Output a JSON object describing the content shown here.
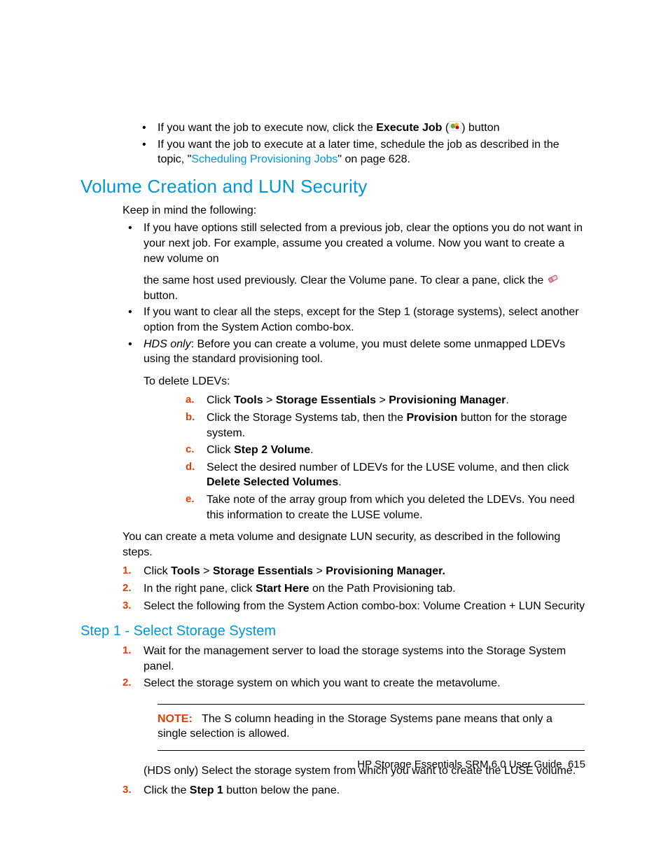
{
  "top_bullets": {
    "b1_pre": "If you want the job to execute now, click the ",
    "b1_bold": "Execute Job",
    "b1_post_a": " (",
    "b1_post_b": ") button",
    "b2_pre": "If you want the job to execute at a later time, schedule the job as described in the topic, \"",
    "b2_link": "Scheduling Provisioning Jobs",
    "b2_post": "\" on page 628."
  },
  "section1": {
    "heading": "Volume Creation and LUN Security",
    "intro": "Keep in mind the following:",
    "bullets": {
      "b1a": "If you have options still selected from a previous job, clear the options you do not want in your next job. For example, assume you created a volume. Now you want to create a new volume on",
      "b1b_pre": "the same host used previously. Clear the Volume pane. To clear a pane, click the ",
      "b1b_post": " button.",
      "b2": "If you want to clear all the steps, except for the Step 1 (storage systems), select another option from the System Action combo-box.",
      "b3_ital": "HDS only",
      "b3_rest": ": Before you can create a volume, you must delete some unmapped LDEVs using the standard provisioning tool."
    },
    "delete_ldevs": {
      "intro": "To delete LDEVs:",
      "a_pre": "Click ",
      "a_tools": "Tools",
      "a_gt1": " > ",
      "a_se": "Storage Essentials",
      "a_gt2": " > ",
      "a_pm": "Provisioning Manager",
      "a_dot": ".",
      "b_pre": "Click the Storage Systems tab, then the ",
      "b_bold": "Provision",
      "b_post": " button for the storage system.",
      "c_pre": "Click ",
      "c_bold": "Step 2 Volume",
      "c_dot": ".",
      "d_pre": "Select the desired number of LDEVs for the LUSE volume, and then click ",
      "d_bold": "Delete Selected Volumes",
      "d_dot": ".",
      "e": "Take note of the array group from which you deleted the LDEVs. You need this information to create the LUSE volume."
    },
    "meta_vol_intro": "You can create a meta volume and designate LUN security, as described in the following steps.",
    "numlist": {
      "n1_pre": "Click ",
      "n1_tools": "Tools",
      "n1_gt1": " > ",
      "n1_se": "Storage Essentials",
      "n1_gt2": " > ",
      "n1_pm": "Provisioning Manager.",
      "n2_pre": "In the right pane, click ",
      "n2_bold": "Start Here",
      "n2_post": " on the Path Provisioning tab.",
      "n3": "Select the following from the System Action combo-box: Volume Creation + LUN Security"
    }
  },
  "section2": {
    "heading": "Step 1 - Select Storage System",
    "numlist": {
      "n1": "Wait for the management server to load the storage systems into the Storage System panel.",
      "n2": "Select the storage system on which you want to create the metavolume.",
      "note_label": "NOTE:",
      "note_body": "The S column heading in the Storage Systems pane means that only a single selection is allowed.",
      "hds_line": "(HDS only) Select the storage system from which you want to create the LUSE volume.",
      "n3_pre": "Click the ",
      "n3_bold": "Step 1",
      "n3_post": " button below the pane."
    }
  },
  "footer": {
    "title": "HP Storage Essentials SRM 6.0 User Guide",
    "page": "615"
  },
  "markers": {
    "a": "a.",
    "b": "b.",
    "c": "c.",
    "d": "d.",
    "e": "e.",
    "n1": "1.",
    "n2": "2.",
    "n3": "3."
  }
}
